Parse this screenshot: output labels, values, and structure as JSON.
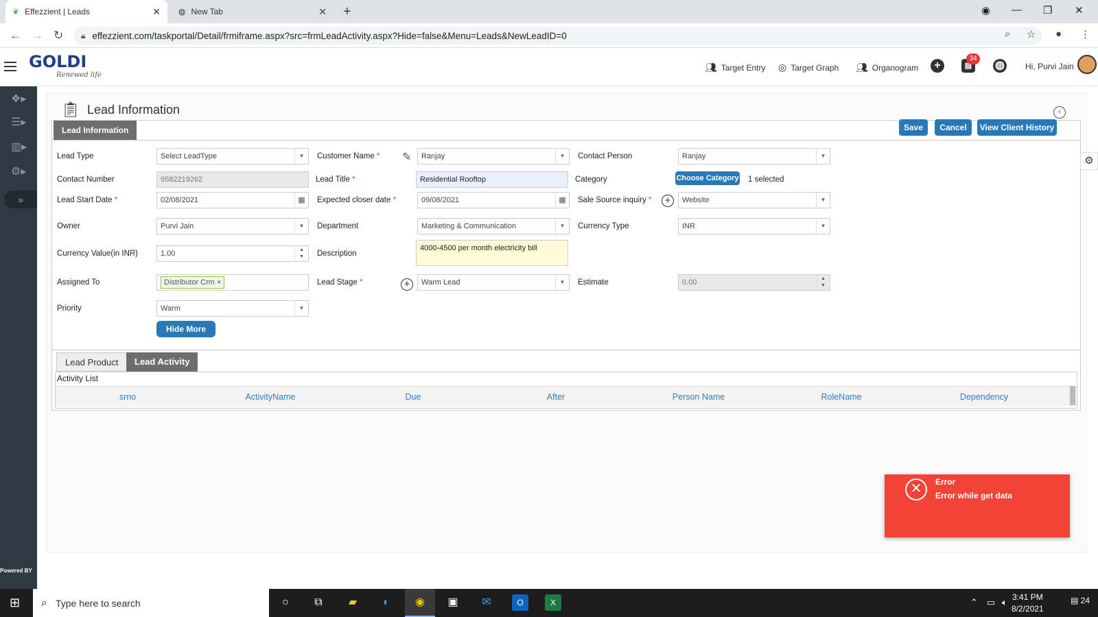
{
  "browser": {
    "tabs": [
      {
        "title": "Effezzient | Leads",
        "active": true
      },
      {
        "title": "New Tab",
        "active": false
      }
    ],
    "url": "effezzient.com/taskportal/Detail/frmiframe.aspx?src=frmLeadActivity.aspx?Hide=false&Menu=Leads&NewLeadID=0"
  },
  "header": {
    "logo_main": "GOLDI",
    "logo_sub": "Renewed life",
    "links": [
      "Target Entry",
      "Target Graph",
      "Organogram"
    ],
    "notif_count": "34",
    "greeting": "Hi, Purvi Jain"
  },
  "sidebar": {
    "powered_by": "Powered BY"
  },
  "page": {
    "title": "Lead Information",
    "section_tab": "Lead Information",
    "buttons": {
      "save": "Save",
      "cancel": "Cancel",
      "history": "View Client History"
    }
  },
  "form": {
    "lead_type": {
      "label": "Lead Type",
      "value": "Select LeadType"
    },
    "customer_name": {
      "label": "Customer Name",
      "value": "Ranjay"
    },
    "contact_person": {
      "label": "Contact Person",
      "value": "Ranjay"
    },
    "contact_number": {
      "label": "Contact Number",
      "value": "9582219262"
    },
    "lead_title": {
      "label": "Lead Title",
      "value": "Residential Rooftop"
    },
    "category": {
      "label": "Category",
      "button": "Choose Category",
      "selected": "1 selected"
    },
    "lead_start_date": {
      "label": "Lead Start Date",
      "value": "02/08/2021"
    },
    "expected_closer_date": {
      "label": "Expected closer date",
      "value": "09/08/2021"
    },
    "sale_source": {
      "label": "Sale Source inquiry",
      "value": "Website"
    },
    "owner": {
      "label": "Owner",
      "value": "Purvi Jain"
    },
    "department": {
      "label": "Department",
      "value": "Marketing & Communication"
    },
    "currency_type": {
      "label": "Currency Type",
      "value": "INR"
    },
    "currency_value": {
      "label": "Currency Value(in INR)",
      "value": "1.00"
    },
    "description": {
      "label": "Description",
      "value": "4000-4500 per month electricity bill"
    },
    "assigned_to": {
      "label": "Assigned To",
      "chip": "Distributor Crm"
    },
    "lead_stage": {
      "label": "Lead Stage",
      "value": "Warm Lead"
    },
    "estimate": {
      "label": "Estimate",
      "value": "0.00"
    },
    "priority": {
      "label": "Priority",
      "value": "Warm"
    },
    "hide_more": "Hide More"
  },
  "subtabs": [
    "Lead Product",
    "Lead Activity"
  ],
  "activity": {
    "title": "Activity List",
    "columns": [
      "srno",
      "ActivityName",
      "Due",
      "After",
      "Person Name",
      "RoleName",
      "Dependency"
    ]
  },
  "toast": {
    "title": "Error",
    "message": "Error while get data"
  },
  "taskbar": {
    "search_placeholder": "Type here to search",
    "time": "3:41 PM",
    "date": "8/2/2021",
    "notif": "24"
  }
}
